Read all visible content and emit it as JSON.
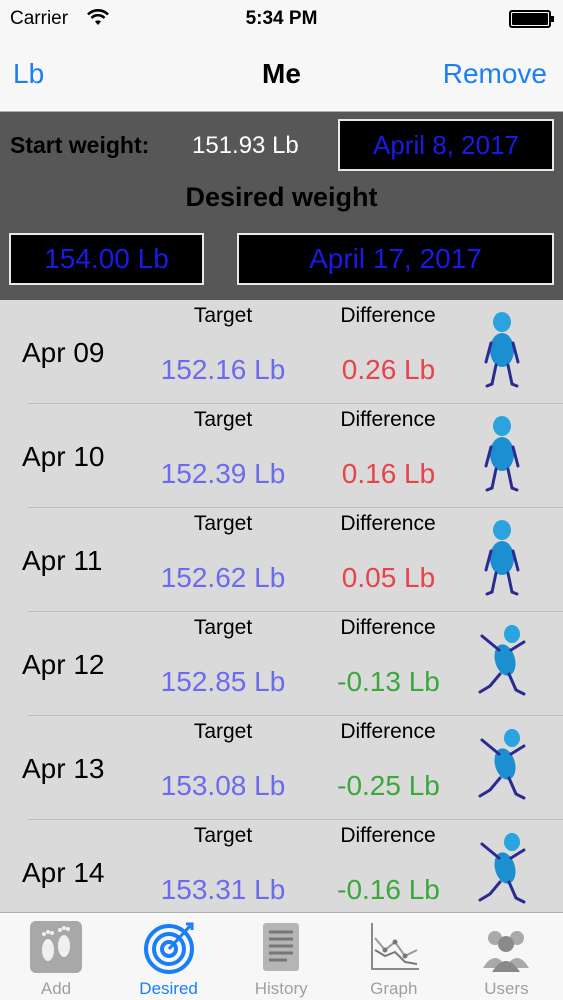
{
  "status_bar": {
    "carrier": "Carrier",
    "time": "5:34 PM"
  },
  "nav": {
    "left": "Lb",
    "title": "Me",
    "right": "Remove"
  },
  "summary": {
    "start_label": "Start weight:",
    "start_value": "151.93 Lb",
    "start_date": "April 8, 2017",
    "desired_label": "Desired weight",
    "desired_value": "154.00 Lb",
    "desired_date": "April 17, 2017"
  },
  "rows": [
    {
      "date": "Apr 09",
      "target_label": "Target",
      "diff_label": "Difference",
      "target": "152.16 Lb",
      "diff": "0.26 Lb",
      "diff_color": "#e8424a",
      "figure": "standing-figure-icon"
    },
    {
      "date": "Apr 10",
      "target_label": "Target",
      "diff_label": "Difference",
      "target": "152.39 Lb",
      "diff": "0.16 Lb",
      "diff_color": "#e8424a",
      "figure": "standing-figure-icon"
    },
    {
      "date": "Apr 11",
      "target_label": "Target",
      "diff_label": "Difference",
      "target": "152.62 Lb",
      "diff": "0.05 Lb",
      "diff_color": "#e8424a",
      "figure": "standing-figure-icon"
    },
    {
      "date": "Apr 12",
      "target_label": "Target",
      "diff_label": "Difference",
      "target": "152.85 Lb",
      "diff": "-0.13 Lb",
      "diff_color": "#3aa83a",
      "figure": "jumping-figure-icon"
    },
    {
      "date": "Apr 13",
      "target_label": "Target",
      "diff_label": "Difference",
      "target": "153.08 Lb",
      "diff": "-0.25 Lb",
      "diff_color": "#3aa83a",
      "figure": "jumping-figure-icon"
    },
    {
      "date": "Apr 14",
      "target_label": "Target",
      "diff_label": "Difference",
      "target": "153.31 Lb",
      "diff": "-0.16 Lb",
      "diff_color": "#3aa83a",
      "figure": "jumping-figure-icon"
    }
  ],
  "tabs": [
    {
      "label": "Add",
      "icon": "footprints-icon"
    },
    {
      "label": "Desired",
      "icon": "target-icon"
    },
    {
      "label": "History",
      "icon": "document-icon"
    },
    {
      "label": "Graph",
      "icon": "graph-icon"
    },
    {
      "label": "Users",
      "icon": "users-icon"
    }
  ],
  "colors": {
    "accent": "#1a7ff5",
    "positive": "#e8424a",
    "negative": "#3aa83a",
    "target": "#6b6bf0"
  }
}
